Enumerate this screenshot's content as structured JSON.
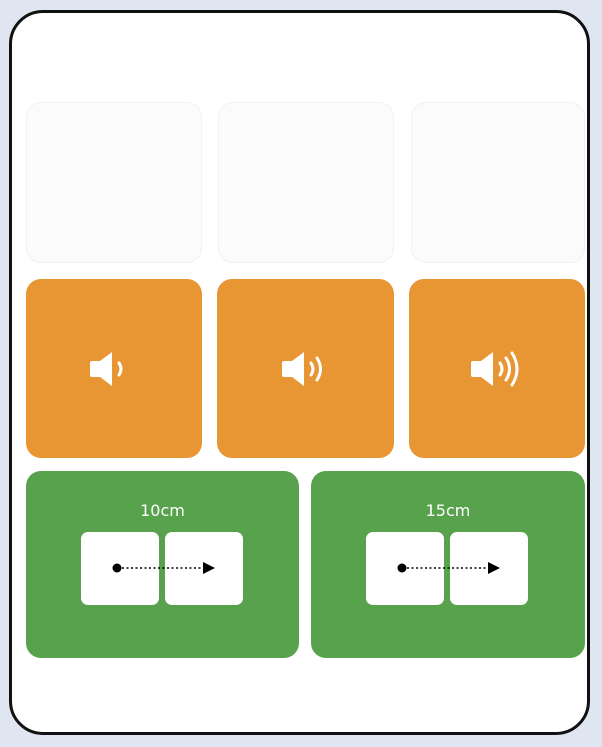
{
  "rows": {
    "blank": [
      {
        "id": "blank-1"
      },
      {
        "id": "blank-2"
      },
      {
        "id": "blank-3"
      }
    ],
    "sound": [
      {
        "icon": "speaker-low-volume-icon",
        "waves": 1
      },
      {
        "icon": "speaker-medium-volume-icon",
        "waves": 2
      },
      {
        "icon": "speaker-high-volume-icon",
        "waves": 3
      }
    ],
    "distance": [
      {
        "label": "10cm",
        "icon": "dotted-arrow-icon"
      },
      {
        "label": "15cm",
        "icon": "dotted-arrow-icon"
      }
    ]
  },
  "colors": {
    "sound_tile": "#e89634",
    "distance_tile": "#58a14d",
    "blank_tile": "#fbfbfb",
    "frame_border": "#111111"
  }
}
